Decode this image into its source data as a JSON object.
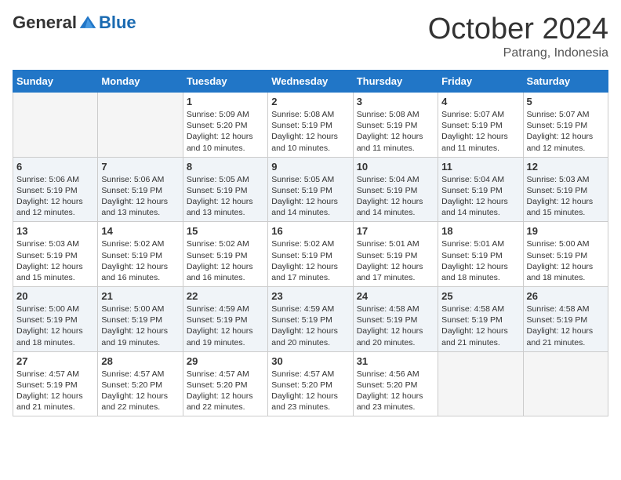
{
  "header": {
    "logo_general": "General",
    "logo_blue": "Blue",
    "month": "October 2024",
    "location": "Patrang, Indonesia"
  },
  "weekdays": [
    "Sunday",
    "Monday",
    "Tuesday",
    "Wednesday",
    "Thursday",
    "Friday",
    "Saturday"
  ],
  "weeks": [
    [
      {
        "day": "",
        "info": ""
      },
      {
        "day": "",
        "info": ""
      },
      {
        "day": "1",
        "info": "Sunrise: 5:09 AM\nSunset: 5:20 PM\nDaylight: 12 hours\nand 10 minutes."
      },
      {
        "day": "2",
        "info": "Sunrise: 5:08 AM\nSunset: 5:19 PM\nDaylight: 12 hours\nand 10 minutes."
      },
      {
        "day": "3",
        "info": "Sunrise: 5:08 AM\nSunset: 5:19 PM\nDaylight: 12 hours\nand 11 minutes."
      },
      {
        "day": "4",
        "info": "Sunrise: 5:07 AM\nSunset: 5:19 PM\nDaylight: 12 hours\nand 11 minutes."
      },
      {
        "day": "5",
        "info": "Sunrise: 5:07 AM\nSunset: 5:19 PM\nDaylight: 12 hours\nand 12 minutes."
      }
    ],
    [
      {
        "day": "6",
        "info": "Sunrise: 5:06 AM\nSunset: 5:19 PM\nDaylight: 12 hours\nand 12 minutes."
      },
      {
        "day": "7",
        "info": "Sunrise: 5:06 AM\nSunset: 5:19 PM\nDaylight: 12 hours\nand 13 minutes."
      },
      {
        "day": "8",
        "info": "Sunrise: 5:05 AM\nSunset: 5:19 PM\nDaylight: 12 hours\nand 13 minutes."
      },
      {
        "day": "9",
        "info": "Sunrise: 5:05 AM\nSunset: 5:19 PM\nDaylight: 12 hours\nand 14 minutes."
      },
      {
        "day": "10",
        "info": "Sunrise: 5:04 AM\nSunset: 5:19 PM\nDaylight: 12 hours\nand 14 minutes."
      },
      {
        "day": "11",
        "info": "Sunrise: 5:04 AM\nSunset: 5:19 PM\nDaylight: 12 hours\nand 14 minutes."
      },
      {
        "day": "12",
        "info": "Sunrise: 5:03 AM\nSunset: 5:19 PM\nDaylight: 12 hours\nand 15 minutes."
      }
    ],
    [
      {
        "day": "13",
        "info": "Sunrise: 5:03 AM\nSunset: 5:19 PM\nDaylight: 12 hours\nand 15 minutes."
      },
      {
        "day": "14",
        "info": "Sunrise: 5:02 AM\nSunset: 5:19 PM\nDaylight: 12 hours\nand 16 minutes."
      },
      {
        "day": "15",
        "info": "Sunrise: 5:02 AM\nSunset: 5:19 PM\nDaylight: 12 hours\nand 16 minutes."
      },
      {
        "day": "16",
        "info": "Sunrise: 5:02 AM\nSunset: 5:19 PM\nDaylight: 12 hours\nand 17 minutes."
      },
      {
        "day": "17",
        "info": "Sunrise: 5:01 AM\nSunset: 5:19 PM\nDaylight: 12 hours\nand 17 minutes."
      },
      {
        "day": "18",
        "info": "Sunrise: 5:01 AM\nSunset: 5:19 PM\nDaylight: 12 hours\nand 18 minutes."
      },
      {
        "day": "19",
        "info": "Sunrise: 5:00 AM\nSunset: 5:19 PM\nDaylight: 12 hours\nand 18 minutes."
      }
    ],
    [
      {
        "day": "20",
        "info": "Sunrise: 5:00 AM\nSunset: 5:19 PM\nDaylight: 12 hours\nand 18 minutes."
      },
      {
        "day": "21",
        "info": "Sunrise: 5:00 AM\nSunset: 5:19 PM\nDaylight: 12 hours\nand 19 minutes."
      },
      {
        "day": "22",
        "info": "Sunrise: 4:59 AM\nSunset: 5:19 PM\nDaylight: 12 hours\nand 19 minutes."
      },
      {
        "day": "23",
        "info": "Sunrise: 4:59 AM\nSunset: 5:19 PM\nDaylight: 12 hours\nand 20 minutes."
      },
      {
        "day": "24",
        "info": "Sunrise: 4:58 AM\nSunset: 5:19 PM\nDaylight: 12 hours\nand 20 minutes."
      },
      {
        "day": "25",
        "info": "Sunrise: 4:58 AM\nSunset: 5:19 PM\nDaylight: 12 hours\nand 21 minutes."
      },
      {
        "day": "26",
        "info": "Sunrise: 4:58 AM\nSunset: 5:19 PM\nDaylight: 12 hours\nand 21 minutes."
      }
    ],
    [
      {
        "day": "27",
        "info": "Sunrise: 4:57 AM\nSunset: 5:19 PM\nDaylight: 12 hours\nand 21 minutes."
      },
      {
        "day": "28",
        "info": "Sunrise: 4:57 AM\nSunset: 5:20 PM\nDaylight: 12 hours\nand 22 minutes."
      },
      {
        "day": "29",
        "info": "Sunrise: 4:57 AM\nSunset: 5:20 PM\nDaylight: 12 hours\nand 22 minutes."
      },
      {
        "day": "30",
        "info": "Sunrise: 4:57 AM\nSunset: 5:20 PM\nDaylight: 12 hours\nand 23 minutes."
      },
      {
        "day": "31",
        "info": "Sunrise: 4:56 AM\nSunset: 5:20 PM\nDaylight: 12 hours\nand 23 minutes."
      },
      {
        "day": "",
        "info": ""
      },
      {
        "day": "",
        "info": ""
      }
    ]
  ]
}
